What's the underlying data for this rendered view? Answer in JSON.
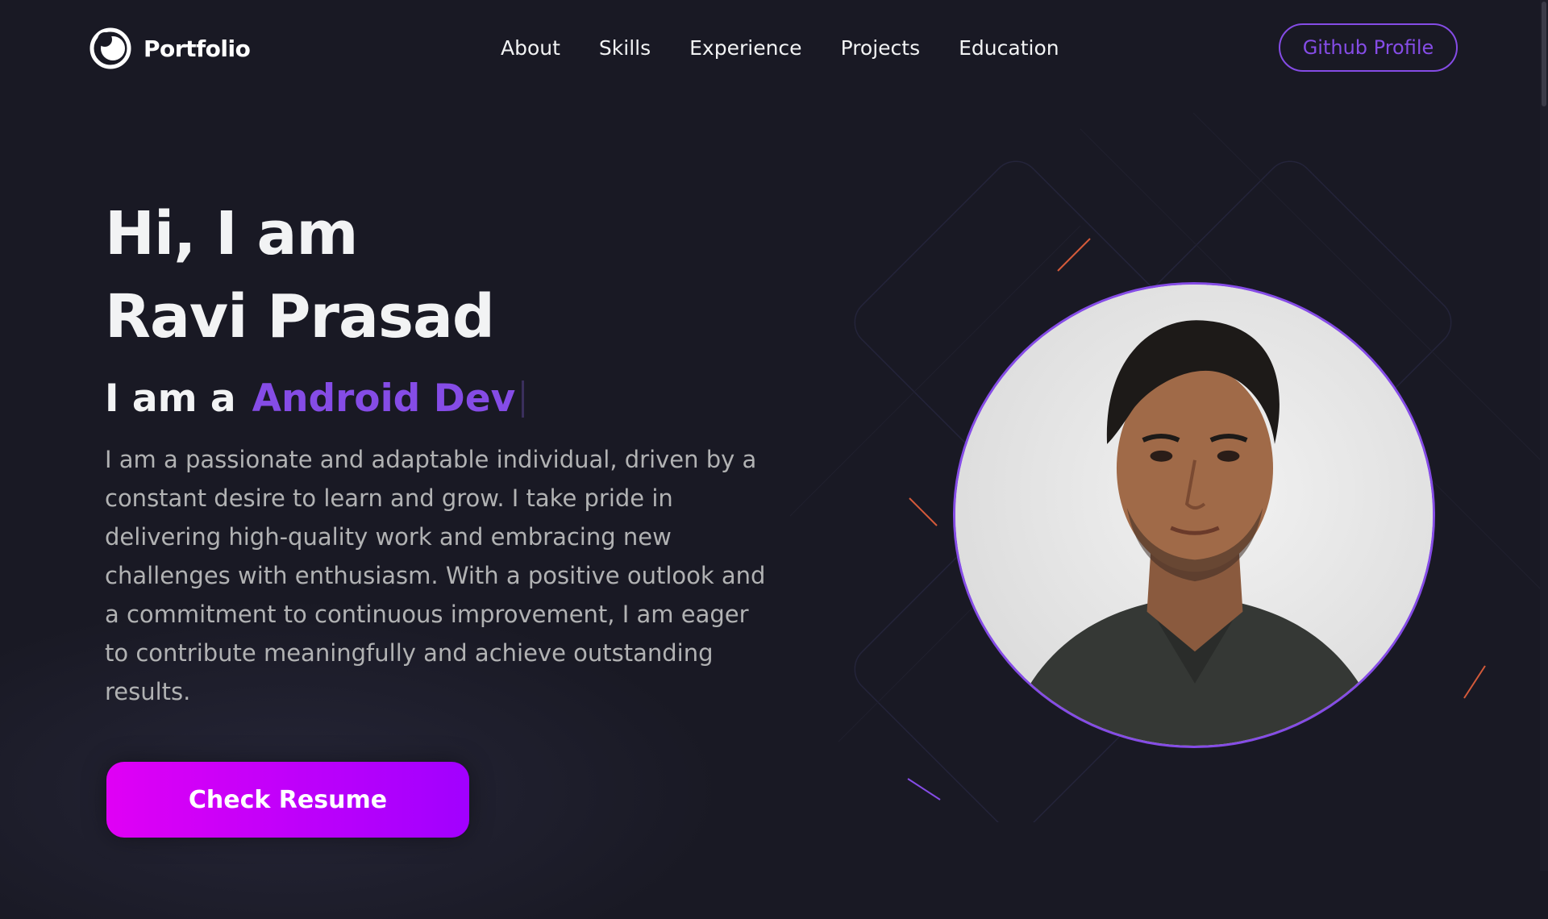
{
  "nav": {
    "logo_text": "Portfolio",
    "links": [
      "About",
      "Skills",
      "Experience",
      "Projects",
      "Education"
    ],
    "github_label": "Github Profile"
  },
  "hero": {
    "greeting": "Hi, I am",
    "name": "Ravi Prasad",
    "role_prefix": "I am a",
    "role_value": "Android Dev",
    "description": "I am a passionate and adaptable individual, driven by a constant desire to learn and grow. I take pride in delivering high-quality work and embracing new challenges with enthusiasm. With a positive outlook and a commitment to continuous improvement, I am eager to contribute meaningfully and achieve outstanding results.",
    "resume_label": "Check Resume"
  },
  "colors": {
    "background": "#191924",
    "primary": "#854ce6",
    "text_primary": "#f2f3f4",
    "text_secondary": "#b1b2b3",
    "button_gradient_start": "#e000f5",
    "button_gradient_end": "#a100ff"
  },
  "icons": {
    "logo": "logo-circle-icon"
  }
}
